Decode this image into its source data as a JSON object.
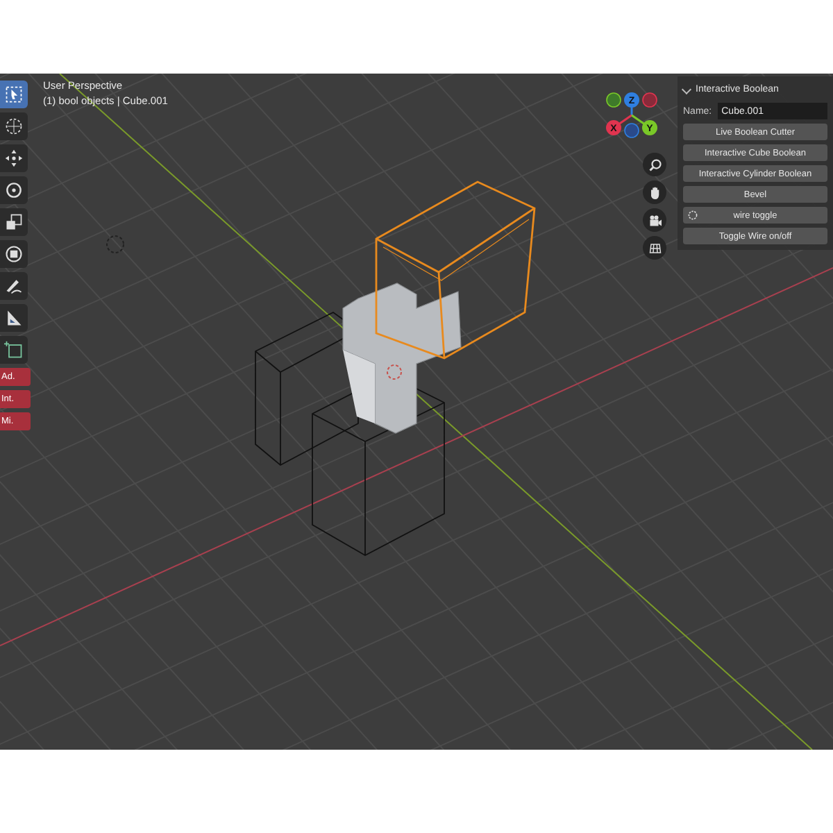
{
  "viewport": {
    "header": {
      "title": "User Perspective",
      "subtitle": "(1) bool objects | Cube.001"
    },
    "toolbar": {
      "tools": [
        {
          "kind": "select",
          "selected": true
        },
        {
          "kind": "cursor",
          "selected": false
        },
        {
          "kind": "move",
          "selected": false
        },
        {
          "kind": "rotate",
          "selected": false
        },
        {
          "kind": "scale",
          "selected": false
        },
        {
          "kind": "transform",
          "selected": false
        },
        {
          "kind": "annotate",
          "selected": false
        },
        {
          "kind": "measure",
          "selected": false
        },
        {
          "kind": "add-cube",
          "selected": false
        }
      ],
      "addon_buttons": [
        {
          "label": "Ad."
        },
        {
          "label": "Int."
        },
        {
          "label": "Mi."
        }
      ]
    },
    "gizmo": {
      "axes": [
        {
          "label": "Z",
          "color": "#2f7fe0"
        },
        {
          "label": "X",
          "color": "#e0344f"
        },
        {
          "label": "Y",
          "color": "#7ac828"
        }
      ]
    },
    "panel": {
      "title": "Interactive Boolean",
      "expanded": true,
      "name_label": "Name:",
      "name_value": "Cube.001",
      "buttons": [
        {
          "label": "Live Boolean Cutter",
          "kind": "plain"
        },
        {
          "label": "Interactive Cube Boolean",
          "kind": "plain"
        },
        {
          "label": "Interactive Cylinder Boolean",
          "kind": "plain"
        },
        {
          "label": "Bevel",
          "kind": "plain"
        },
        {
          "label": "wire toggle",
          "kind": "icon"
        },
        {
          "label": "Toggle Wire on/off",
          "kind": "plain"
        }
      ]
    }
  }
}
